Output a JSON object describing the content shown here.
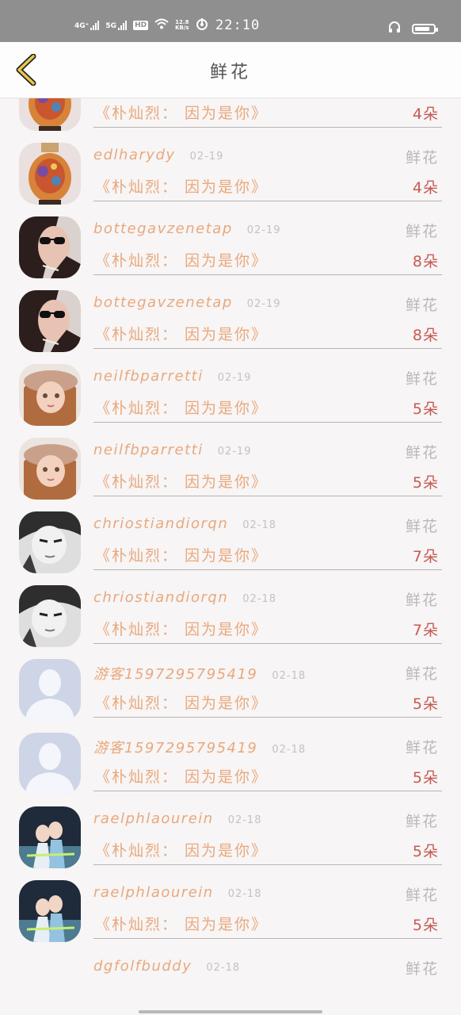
{
  "status_bar": {
    "network_1": "4G⁺",
    "network_2": "5G",
    "hd_label": "HD",
    "speed_value": "12.8",
    "speed_unit": "KB/s",
    "time": "22:10"
  },
  "header": {
    "title": "鲜花"
  },
  "colors": {
    "accent": "#e9a87d",
    "quantity": "#c65a54",
    "back_icon": "#e8c84c"
  },
  "items": [
    {
      "username": "edlharydy",
      "date": "02-19",
      "gift": "鲜花",
      "song": "《朴灿烈： 因为是你》",
      "quantity": "4朵",
      "avatar": "vase-avatar"
    },
    {
      "username": "edlharydy",
      "date": "02-19",
      "gift": "鲜花",
      "song": "《朴灿烈： 因为是你》",
      "quantity": "4朵",
      "avatar": "vase-avatar"
    },
    {
      "username": "bottegavzenetap",
      "date": "02-19",
      "gift": "鲜花",
      "song": "《朴灿烈： 因为是你》",
      "quantity": "8朵",
      "avatar": "sunglasses-avatar"
    },
    {
      "username": "bottegavzenetap",
      "date": "02-19",
      "gift": "鲜花",
      "song": "《朴灿烈： 因为是你》",
      "quantity": "8朵",
      "avatar": "sunglasses-avatar"
    },
    {
      "username": "neilfbparretti",
      "date": "02-19",
      "gift": "鲜花",
      "song": "《朴灿烈： 因为是你》",
      "quantity": "5朵",
      "avatar": "doll-avatar"
    },
    {
      "username": "neilfbparretti",
      "date": "02-19",
      "gift": "鲜花",
      "song": "《朴灿烈： 因为是你》",
      "quantity": "5朵",
      "avatar": "doll-avatar"
    },
    {
      "username": "chriostiandiorqn",
      "date": "02-18",
      "gift": "鲜花",
      "song": "《朴灿烈： 因为是你》",
      "quantity": "7朵",
      "avatar": "bw-portrait-avatar"
    },
    {
      "username": "chriostiandiorqn",
      "date": "02-18",
      "gift": "鲜花",
      "song": "《朴灿烈： 因为是你》",
      "quantity": "7朵",
      "avatar": "bw-portrait-avatar"
    },
    {
      "username": "游客1597295795419",
      "date": "02-18",
      "gift": "鲜花",
      "song": "《朴灿烈： 因为是你》",
      "quantity": "5朵",
      "avatar": "default-avatar"
    },
    {
      "username": "游客1597295795419",
      "date": "02-18",
      "gift": "鲜花",
      "song": "《朴灿烈： 因为是你》",
      "quantity": "5朵",
      "avatar": "default-avatar"
    },
    {
      "username": "raelphlaourein",
      "date": "02-18",
      "gift": "鲜花",
      "song": "《朴灿烈： 因为是你》",
      "quantity": "5朵",
      "avatar": "couple-avatar"
    },
    {
      "username": "raelphlaourein",
      "date": "02-18",
      "gift": "鲜花",
      "song": "《朴灿烈： 因为是你》",
      "quantity": "5朵",
      "avatar": "couple-avatar"
    },
    {
      "username": "dgfolfbuddy",
      "date": "02-18",
      "gift": "鲜花",
      "song": "",
      "quantity": "",
      "avatar": "none"
    }
  ]
}
